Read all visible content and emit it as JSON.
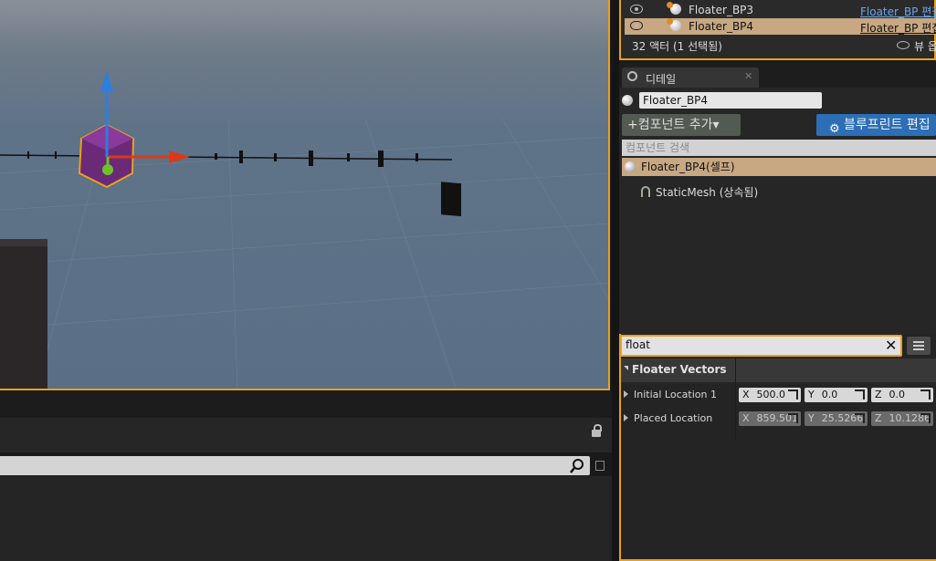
{
  "outliner": {
    "rows": [
      {
        "name": "Floater_BP3",
        "type": "Floater_BP 편집"
      },
      {
        "name": "Floater_BP4",
        "type": "Floater_BP 편집"
      }
    ],
    "actor_count": "32 액터 (1 선택됨)",
    "view_options": "뷰 옵"
  },
  "details": {
    "tab_label": "디테일",
    "actor_name": "Floater_BP4",
    "add_component": "+컴포넌트 추가▾",
    "blueprint_edit": "블루프린트 편집",
    "component_search_placeholder": "컴포넌트 검색",
    "self_component": "Floater_BP4(셀프)",
    "static_mesh_component": "StaticMesh (상속됨)",
    "filter_value": "float",
    "category": "Floater Vectors",
    "properties": [
      {
        "label": "Initial Location 1",
        "x": "500.0",
        "y": "0.0",
        "z": "0.0"
      },
      {
        "label": "Placed Location",
        "x": "859.501",
        "y": "25.5266",
        "z": "10.1286"
      }
    ]
  },
  "axis_labels": {
    "x": "X",
    "y": "Y",
    "z": "Z"
  },
  "colors": {
    "selection_outline": "#e8a21b",
    "blueprint_button": "#2c6fb6",
    "selected_row": "#c7a882"
  }
}
